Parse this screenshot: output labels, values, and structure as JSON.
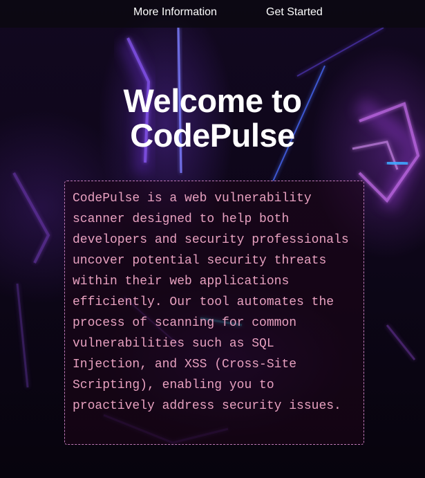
{
  "nav": {
    "more_info_label": "More Information",
    "get_started_label": "Get Started"
  },
  "hero": {
    "title_line1": "Welcome to",
    "title_line2": "CodePulse"
  },
  "description": {
    "text": "CodePulse is a web vulnerability scanner designed to help both developers and security professionals uncover potential security threats within their web applications efficiently. Our tool automates the process of scanning for common vulnerabilities such as SQL Injection, and XSS (Cross-Site Scripting), enabling you to proactively address security issues."
  },
  "colors": {
    "title": "#ffffff",
    "description_text": "#e8a1c0",
    "box_border": "#c07ab8",
    "nav_text": "#ffffff"
  }
}
